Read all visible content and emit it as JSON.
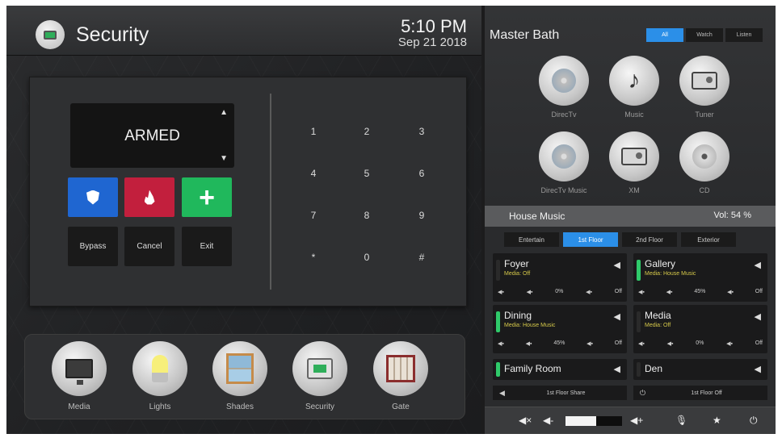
{
  "header": {
    "title": "Security",
    "time": "5:10 PM",
    "date": "Sep 21 2018"
  },
  "security": {
    "status": "ARMED",
    "buttons": [
      "Bypass",
      "Cancel",
      "Exit"
    ],
    "keypad": [
      "1",
      "2",
      "3",
      "4",
      "5",
      "6",
      "7",
      "8",
      "9",
      "*",
      "0",
      "#"
    ]
  },
  "dock": [
    {
      "label": "Media",
      "icon": "monitor-icon"
    },
    {
      "label": "Lights",
      "icon": "bulb-icon"
    },
    {
      "label": "Shades",
      "icon": "window-icon"
    },
    {
      "label": "Security",
      "icon": "security-panel-icon"
    },
    {
      "label": "Gate",
      "icon": "gate-icon"
    }
  ],
  "room": {
    "title": "Master Bath",
    "modes": [
      "All",
      "Watch",
      "Listen"
    ],
    "active_mode": "All",
    "sources": [
      {
        "label": "DirecTv",
        "icon": "satellite-disc-icon"
      },
      {
        "label": "Music",
        "icon": "music-note-icon"
      },
      {
        "label": "Tuner",
        "icon": "radio-icon"
      },
      {
        "label": "DirecTv Music",
        "icon": "satellite-disc-icon"
      },
      {
        "label": "XM",
        "icon": "radio-icon"
      },
      {
        "label": "CD",
        "icon": "cd-icon"
      }
    ]
  },
  "house_music": {
    "title": "House Music",
    "volume": "Vol: 54 %",
    "floors": [
      "Entertain",
      "1st Floor",
      "2nd Floor",
      "Exterior"
    ],
    "active_floor": "1st Floor",
    "zones": [
      {
        "name": "Foyer",
        "media": "Media: Off",
        "volume": "0%",
        "power": "Off",
        "active": false
      },
      {
        "name": "Gallery",
        "media": "Media: House Music",
        "volume": "45%",
        "power": "Off",
        "active": true
      },
      {
        "name": "Dining",
        "media": "Media: House Music",
        "volume": "45%",
        "power": "Off",
        "active": true
      },
      {
        "name": "Media",
        "media": "Media: Off",
        "volume": "0%",
        "power": "Off",
        "active": false
      },
      {
        "name": "Family Room",
        "active": true
      },
      {
        "name": "Den",
        "active": false
      }
    ],
    "floor_share": "1st Floor Share",
    "floor_off": "1st Floor Off"
  },
  "volume_level": 0.54,
  "colors": {
    "accent_blue": "#2b8fe8",
    "zone_active_green": "#2fca6a",
    "media_text_yellow": "#d6c94a",
    "security_blue": "#1f66d1",
    "security_red": "#c21f3d",
    "security_green": "#20b85c"
  }
}
